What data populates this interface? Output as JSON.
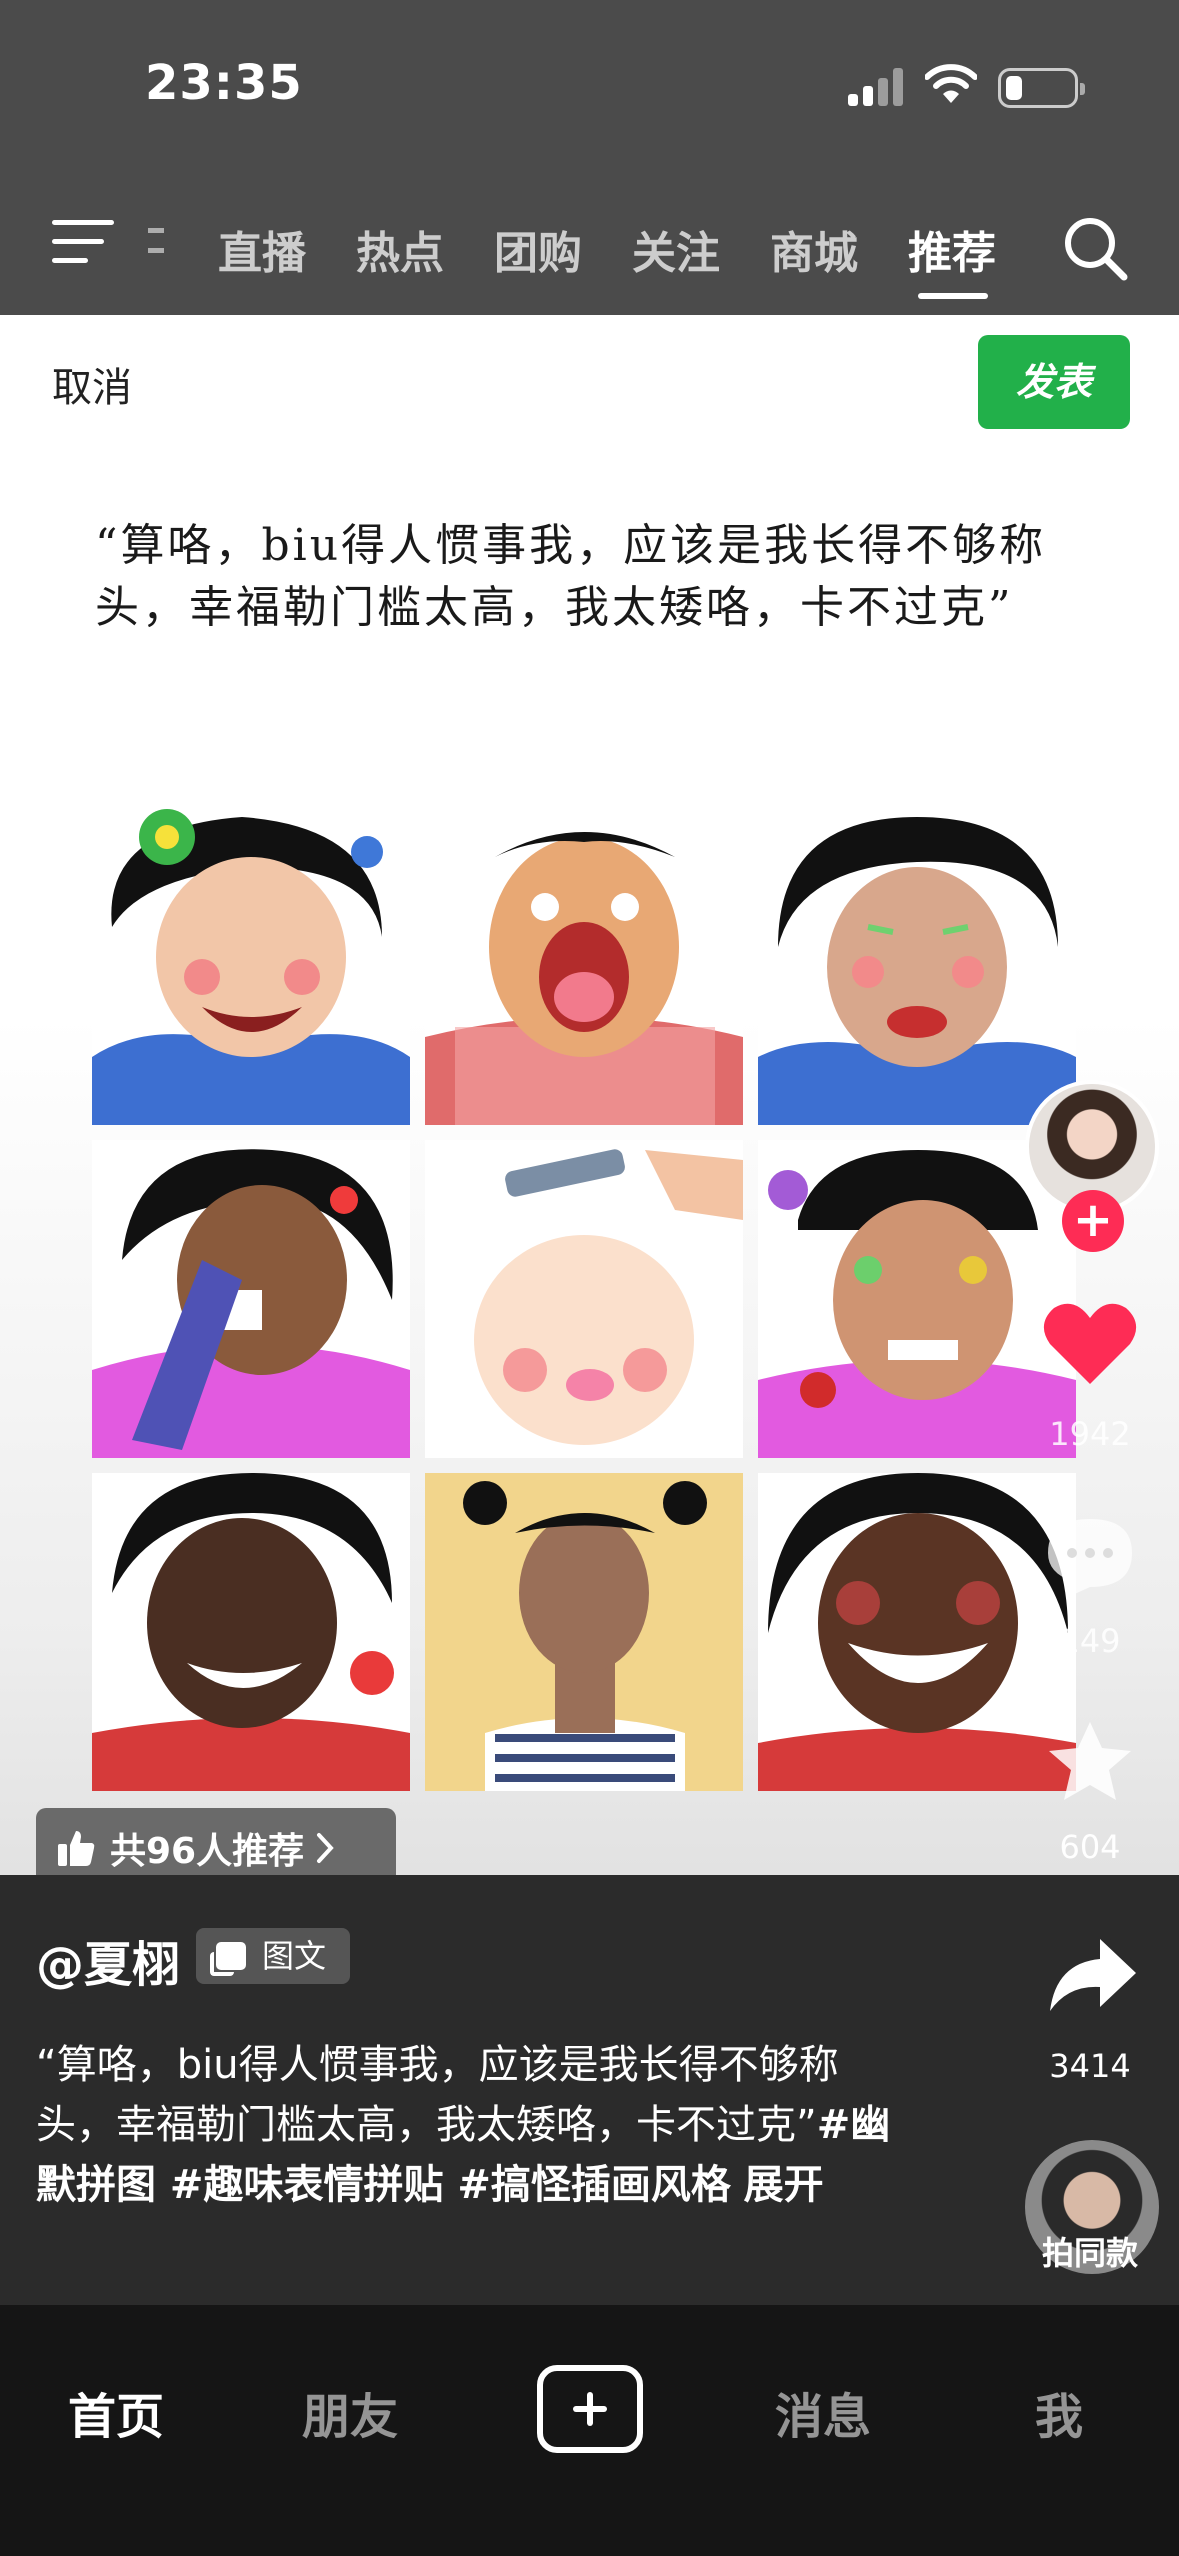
{
  "status_bar": {
    "time": "23:35"
  },
  "top_tabs": {
    "items": [
      {
        "label": "直播"
      },
      {
        "label": "热点"
      },
      {
        "label": "团购"
      },
      {
        "label": "关注"
      },
      {
        "label": "商城"
      },
      {
        "label": "推荐",
        "active": true
      }
    ]
  },
  "post_editor": {
    "cancel_label": "取消",
    "publish_label": "发表",
    "quote_text": "“算咯，biu得人惯事我，应该是我长得不够称头，幸福勒门槛太高，我太矮咯，卡不过克”"
  },
  "image_grid": {
    "images": [
      {
        "name": "caricature-1"
      },
      {
        "name": "caricature-2"
      },
      {
        "name": "caricature-3"
      },
      {
        "name": "caricature-4"
      },
      {
        "name": "caricature-5"
      },
      {
        "name": "caricature-6"
      },
      {
        "name": "caricature-7"
      },
      {
        "name": "caricature-8"
      },
      {
        "name": "caricature-9"
      }
    ]
  },
  "recommend_pill": {
    "label": "共96人推荐"
  },
  "right_rail": {
    "like_count": "1942",
    "comment_count": "149",
    "favorite_count": "604",
    "share_count": "3414",
    "same_style_label": "拍同款"
  },
  "caption": {
    "author": "@夏栩",
    "type_badge": "图文",
    "text": "“算咯，biu得人惯事我，应该是我长得不够称头，幸福勒门槛太高，我太矮咯，卡不过克”",
    "tags": "#幽默拼图 #趣味表情拼贴 #搞怪插画风格",
    "more_label": "展开"
  },
  "bottom_nav": {
    "home": "首页",
    "friends": "朋友",
    "messages": "消息",
    "me": "我"
  },
  "colors": {
    "accent_red": "#fe2c55",
    "publish_green": "#22b04a"
  }
}
